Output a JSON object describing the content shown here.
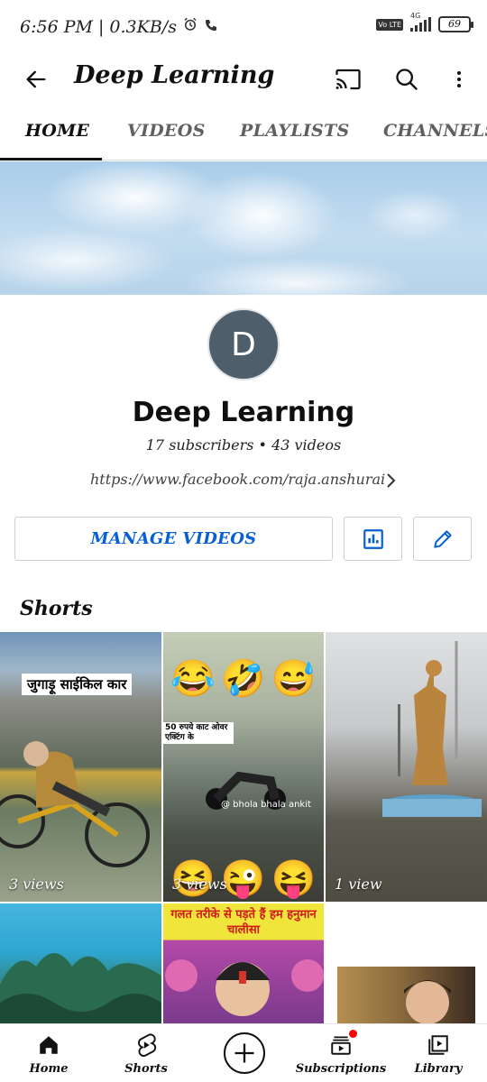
{
  "status_bar": {
    "time_speed": "6:56 PM | 0.3KB/s",
    "network": "4G",
    "volte": "Vo LTE",
    "battery": "69"
  },
  "app_bar": {
    "title": "Deep Learning",
    "icons": [
      "back-arrow-icon",
      "cast-icon",
      "search-icon",
      "more-vert-icon"
    ]
  },
  "tabs": [
    {
      "label": "HOME",
      "active": true
    },
    {
      "label": "VIDEOS",
      "active": false
    },
    {
      "label": "PLAYLISTS",
      "active": false
    },
    {
      "label": "CHANNELS",
      "active": false
    }
  ],
  "channel": {
    "avatar_letter": "D",
    "avatar_color": "#4e5f6b",
    "name": "Deep Learning",
    "meta": "17 subscribers • 43 videos",
    "link": "https://www.facebook.com/raja.anshurai"
  },
  "actions": {
    "manage_label": "MANAGE VIDEOS",
    "accent": "#065fd4"
  },
  "shorts": {
    "heading": "Shorts",
    "items": [
      {
        "views": "3 views",
        "caption": "जुगाड़ू साईकिल कार"
      },
      {
        "views": "3 views",
        "caption": "50 रुपये काट ओवर एक्टिंग के",
        "watermark": "@ bhola bhala ankit"
      },
      {
        "views": "1 view"
      },
      {
        "views": ""
      },
      {
        "views": "",
        "caption": "गलत तरीके से पड़ते हैं हम हनुमान चालीसा"
      },
      {
        "views": ""
      }
    ]
  },
  "bottom_nav": {
    "items": [
      {
        "label": "Home",
        "icon": "home-icon"
      },
      {
        "label": "Shorts",
        "icon": "shorts-icon"
      },
      {
        "label": "",
        "icon": "create-plus-icon"
      },
      {
        "label": "Subscriptions",
        "icon": "subscriptions-icon"
      },
      {
        "label": "Library",
        "icon": "library-icon"
      }
    ]
  }
}
